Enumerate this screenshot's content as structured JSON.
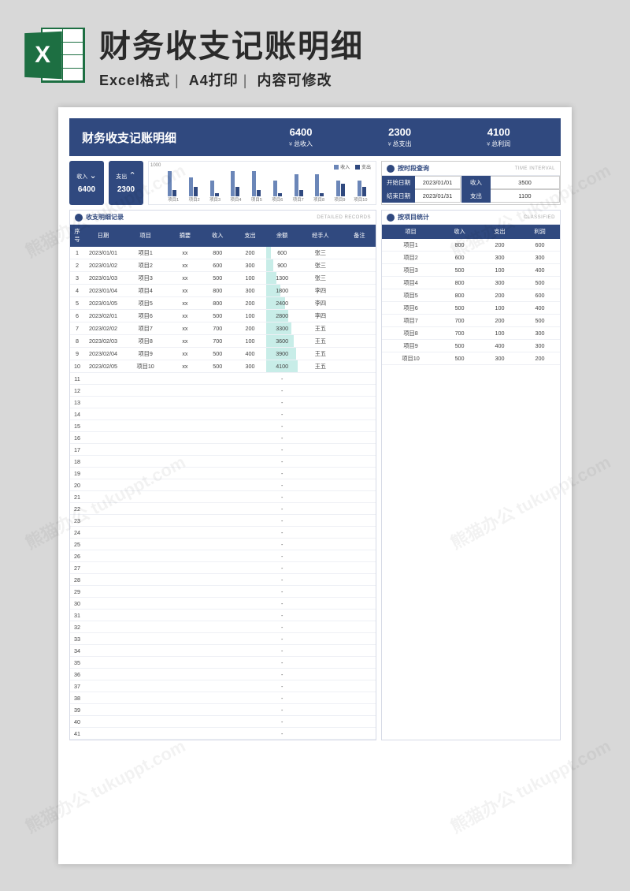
{
  "header": {
    "title": "财务收支记账明细",
    "sub1": "Excel格式",
    "sub2": "A4打印",
    "sub3": "内容可修改",
    "icon_letter": "X"
  },
  "banner": {
    "title": "财务收支记账明细",
    "stats": [
      {
        "num": "6400",
        "label": "总收入"
      },
      {
        "num": "2300",
        "label": "总支出"
      },
      {
        "num": "4100",
        "label": "总利润"
      }
    ]
  },
  "cards": [
    {
      "label": "收入",
      "arrow": "»",
      "num": "6400"
    },
    {
      "label": "支出",
      "arrow": "«",
      "num": "2300"
    }
  ],
  "chart_data": {
    "type": "bar",
    "title": "",
    "ylabel": "",
    "ymax": 1000,
    "legend": [
      "收入",
      "支出"
    ],
    "categories": [
      "项目1",
      "项目2",
      "项目3",
      "项目4",
      "项目5",
      "项目6",
      "项目7",
      "项目8",
      "项目9",
      "项目10"
    ],
    "series": [
      {
        "name": "收入",
        "values": [
          800,
          600,
          500,
          800,
          800,
          500,
          700,
          700,
          500,
          500
        ]
      },
      {
        "name": "支出",
        "values": [
          200,
          300,
          100,
          300,
          200,
          100,
          200,
          100,
          400,
          300
        ]
      }
    ],
    "colors": {
      "收入": "#6b86b8",
      "支出": "#30497f"
    }
  },
  "query": {
    "title": "按时段查询",
    "title_en": "TIME INTERVAL",
    "rows": [
      {
        "l": "开始日期",
        "v": "2023/01/01",
        "l2": "收入",
        "v2": "3500"
      },
      {
        "l": "结束日期",
        "v": "2023/01/31",
        "l2": "支出",
        "v2": "1100"
      }
    ]
  },
  "detail": {
    "title": "收支明细记录",
    "title_en": "DETAILED RECORDS",
    "columns": [
      "序号",
      "日期",
      "项目",
      "摘要",
      "收入",
      "支出",
      "余额",
      "经手人",
      "备注"
    ],
    "rows": [
      {
        "n": 1,
        "d": "2023/01/01",
        "p": "项目1",
        "s": "xx",
        "in": 800,
        "out": 200,
        "bal": 600,
        "h": "张三",
        "r": ""
      },
      {
        "n": 2,
        "d": "2023/01/02",
        "p": "项目2",
        "s": "xx",
        "in": 600,
        "out": 300,
        "bal": 900,
        "h": "张三",
        "r": ""
      },
      {
        "n": 3,
        "d": "2023/01/03",
        "p": "项目3",
        "s": "xx",
        "in": 500,
        "out": 100,
        "bal": 1300,
        "h": "张三",
        "r": ""
      },
      {
        "n": 4,
        "d": "2023/01/04",
        "p": "项目4",
        "s": "xx",
        "in": 800,
        "out": 300,
        "bal": 1800,
        "h": "李四",
        "r": ""
      },
      {
        "n": 5,
        "d": "2023/01/05",
        "p": "项目5",
        "s": "xx",
        "in": 800,
        "out": 200,
        "bal": 2400,
        "h": "李四",
        "r": ""
      },
      {
        "n": 6,
        "d": "2023/02/01",
        "p": "项目6",
        "s": "xx",
        "in": 500,
        "out": 100,
        "bal": 2800,
        "h": "李四",
        "r": ""
      },
      {
        "n": 7,
        "d": "2023/02/02",
        "p": "项目7",
        "s": "xx",
        "in": 700,
        "out": 200,
        "bal": 3300,
        "h": "王五",
        "r": ""
      },
      {
        "n": 8,
        "d": "2023/02/03",
        "p": "项目8",
        "s": "xx",
        "in": 700,
        "out": 100,
        "bal": 3600,
        "h": "王五",
        "r": ""
      },
      {
        "n": 9,
        "d": "2023/02/04",
        "p": "项目9",
        "s": "xx",
        "in": 500,
        "out": 400,
        "bal": 3900,
        "h": "王五",
        "r": ""
      },
      {
        "n": 10,
        "d": "2023/02/05",
        "p": "项目10",
        "s": "xx",
        "in": 500,
        "out": 300,
        "bal": 4100,
        "h": "王五",
        "r": ""
      }
    ],
    "empty_rows": 31,
    "max_balance": 4100
  },
  "byproject": {
    "title": "按项目统计",
    "title_en": "CLASSIFIED",
    "columns": [
      "项目",
      "收入",
      "支出",
      "利润"
    ],
    "rows": [
      {
        "p": "项目1",
        "in": 800,
        "out": 200,
        "pf": 600
      },
      {
        "p": "项目2",
        "in": 600,
        "out": 300,
        "pf": 300
      },
      {
        "p": "项目3",
        "in": 500,
        "out": 100,
        "pf": 400
      },
      {
        "p": "项目4",
        "in": 800,
        "out": 300,
        "pf": 500
      },
      {
        "p": "项目5",
        "in": 800,
        "out": 200,
        "pf": 600
      },
      {
        "p": "项目6",
        "in": 500,
        "out": 100,
        "pf": 400
      },
      {
        "p": "项目7",
        "in": 700,
        "out": 200,
        "pf": 500
      },
      {
        "p": "项目8",
        "in": 700,
        "out": 100,
        "pf": 300
      },
      {
        "p": "项目9",
        "in": 500,
        "out": 400,
        "pf": 300
      },
      {
        "p": "项目10",
        "in": 500,
        "out": 300,
        "pf": 200
      }
    ]
  },
  "watermark": "熊猫办公  tukuppt.com"
}
